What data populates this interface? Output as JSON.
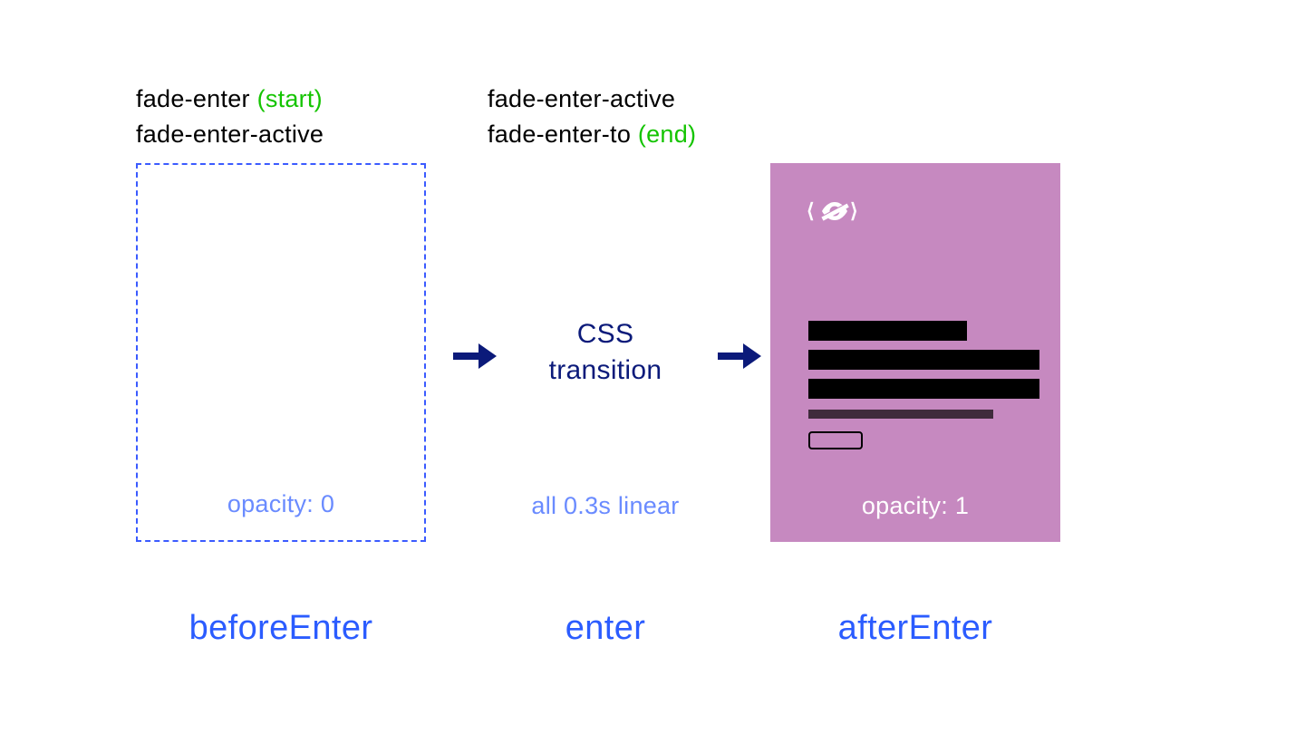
{
  "left": {
    "class_line1_a": "fade-enter ",
    "class_line1_b": "(start)",
    "class_line2": "fade-enter-active",
    "opacity_label": "opacity: 0",
    "hook": "beforeEnter"
  },
  "middle": {
    "class_line1": "fade-enter-active",
    "class_line2_a": "fade-enter-to ",
    "class_line2_b": "(end)",
    "css_transition": "CSS\ntransition",
    "caption": "all 0.3s linear",
    "hook": "enter"
  },
  "right": {
    "opacity_label": "opacity: 1",
    "hook": "afterEnter"
  },
  "colors": {
    "accent_blue": "#2b5cff",
    "dark_blue": "#0b1a7a",
    "light_blue": "#6a8bff",
    "green": "#14c400",
    "purple": "#c689c0"
  }
}
